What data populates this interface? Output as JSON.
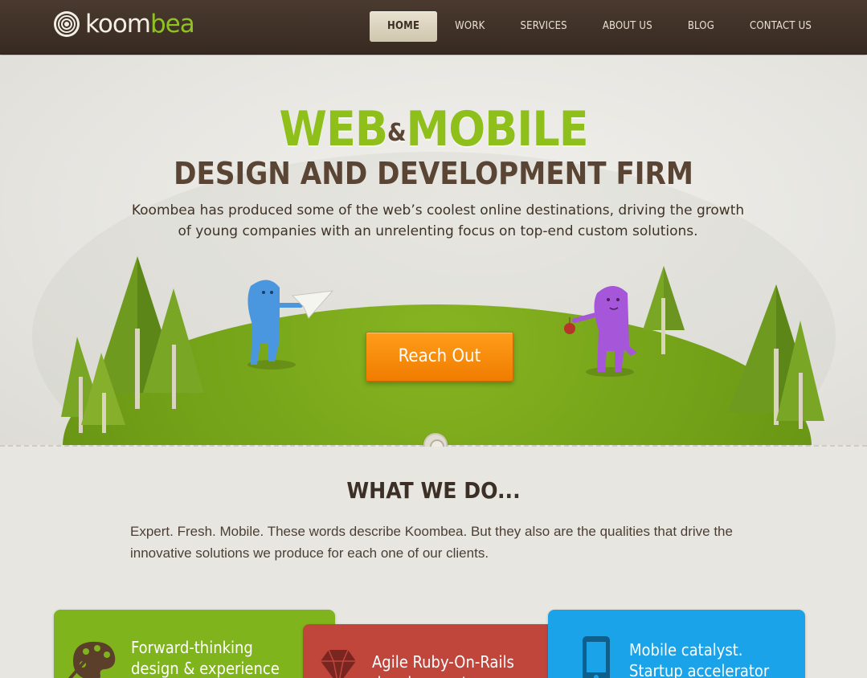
{
  "brand": {
    "name_part1": "koom",
    "name_part2": "bea"
  },
  "nav": {
    "items": [
      {
        "label": "HOME",
        "active": true
      },
      {
        "label": "WORK",
        "active": false
      },
      {
        "label": "SERVICES",
        "active": false
      },
      {
        "label": "ABOUT US",
        "active": false
      },
      {
        "label": "BLOG",
        "active": false
      },
      {
        "label": "CONTACT US",
        "active": false
      }
    ]
  },
  "hero": {
    "headline_web": "WEB",
    "headline_amp": "&",
    "headline_mobile": "MOBILE",
    "subheadline": "DESIGN AND DEVELOPMENT FIRM",
    "intro": "Koombea has produced some of the web’s coolest online destinations, driving the growth of young companies with an unrelenting focus on top-end custom solutions.",
    "cta_label": "Reach Out"
  },
  "what_we_do": {
    "title": "WHAT WE DO...",
    "text": "Expert. Fresh. Mobile. These words describe Koombea. But they also are the qualities that drive the innovative solutions we produce for each one of our clients.",
    "cards": [
      {
        "line1": "Forward-thinking",
        "line2": "design & experience",
        "icon": "palette-icon",
        "color": "#7fb41c"
      },
      {
        "line1": "Agile Ruby-On-Rails",
        "line2": "development",
        "icon": "ruby-icon",
        "color": "#c0463c"
      },
      {
        "line1": "Mobile catalyst.",
        "line2": "Startup accelerator",
        "icon": "mobile-phone-icon",
        "color": "#1aa3e8"
      }
    ]
  },
  "colors": {
    "brand_green": "#8fbf1a",
    "brand_brown": "#5a4434",
    "cta_orange": "#f07c00",
    "nav_bg": "#3f3128"
  }
}
